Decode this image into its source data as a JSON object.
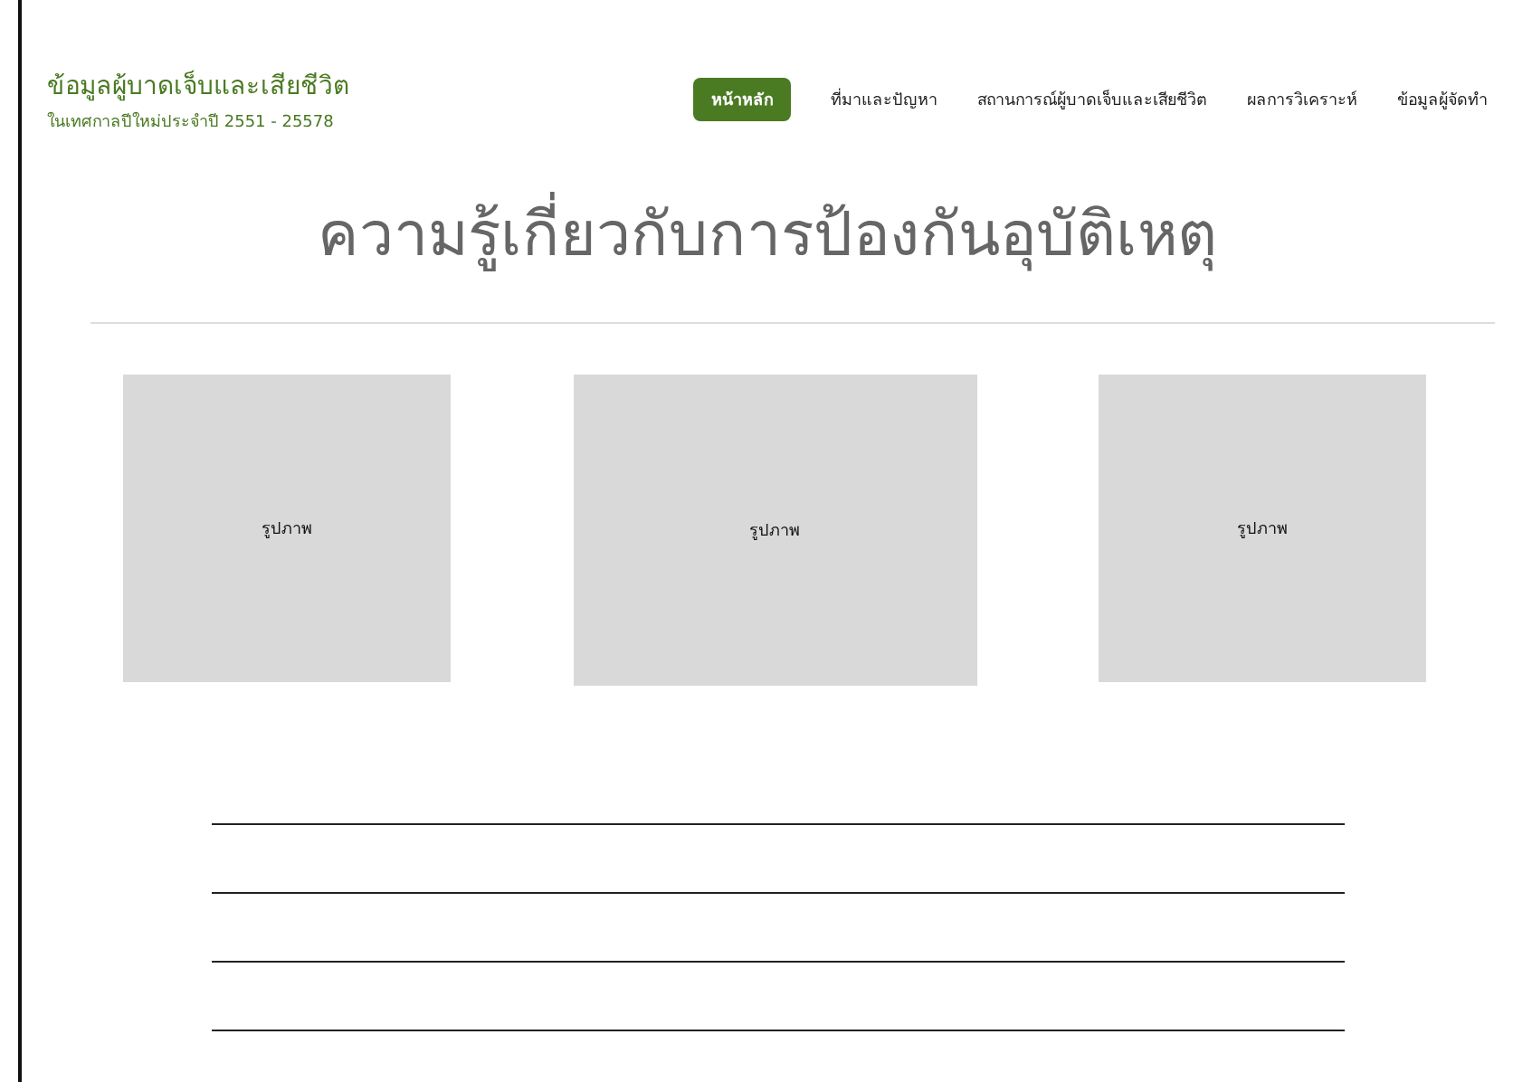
{
  "brand": {
    "title": "ข้อมูลผู้บาดเจ็บและเสียชีวิต",
    "subtitle": "ในเทศกาลปีใหม่ประจำปี 2551 - 25578"
  },
  "nav": [
    {
      "label": "หน้าหลัก",
      "selected": true
    },
    {
      "label": "ที่มาและปัญหา",
      "selected": false
    },
    {
      "label": "สถานการณ์ผู้บาดเจ็บและเสียชีวิต",
      "selected": false
    },
    {
      "label": "ผลการวิเคราะห์",
      "selected": false
    },
    {
      "label": "ข้อมูลผู้จัดทำ",
      "selected": false
    }
  ],
  "heading": "ความรู้เกี่ยวกับการป้องกันอุบัติเหตุ",
  "images": [
    {
      "label": "รูปภาพ"
    },
    {
      "label": "รูปภาพ"
    },
    {
      "label": "รูปภาพ"
    }
  ]
}
